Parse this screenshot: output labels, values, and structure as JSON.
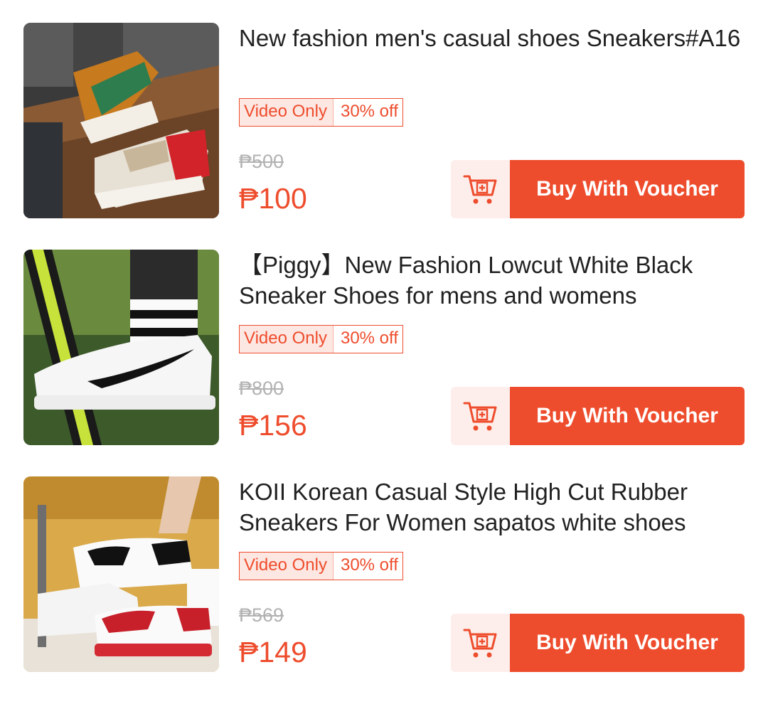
{
  "products": [
    {
      "title": "New fashion men's casual shoes Sneakers#A16",
      "badge": {
        "tag": "Video Only",
        "discount": "30% off"
      },
      "original_price": "₱500",
      "price": "₱100",
      "cart_icon": "add-to-cart-icon",
      "button_label": "Buy With Voucher"
    },
    {
      "title": "【Piggy】New Fashion Lowcut White Black Sneaker Shoes for mens and womens",
      "badge": {
        "tag": "Video Only",
        "discount": "30% off"
      },
      "original_price": "₱800",
      "price": "₱156",
      "cart_icon": "add-to-cart-icon",
      "button_label": "Buy With Voucher"
    },
    {
      "title": "KOII Korean Casual Style High Cut Rubber Sneakers For Women sapatos white shoes",
      "badge": {
        "tag": "Video Only",
        "discount": "30% off"
      },
      "original_price": "₱569",
      "price": "₱149",
      "cart_icon": "add-to-cart-icon",
      "button_label": "Buy With Voucher"
    }
  ],
  "colors": {
    "accent": "#ee4d2d",
    "accent_light": "#fdeeeb",
    "muted": "#b2b2b2"
  }
}
